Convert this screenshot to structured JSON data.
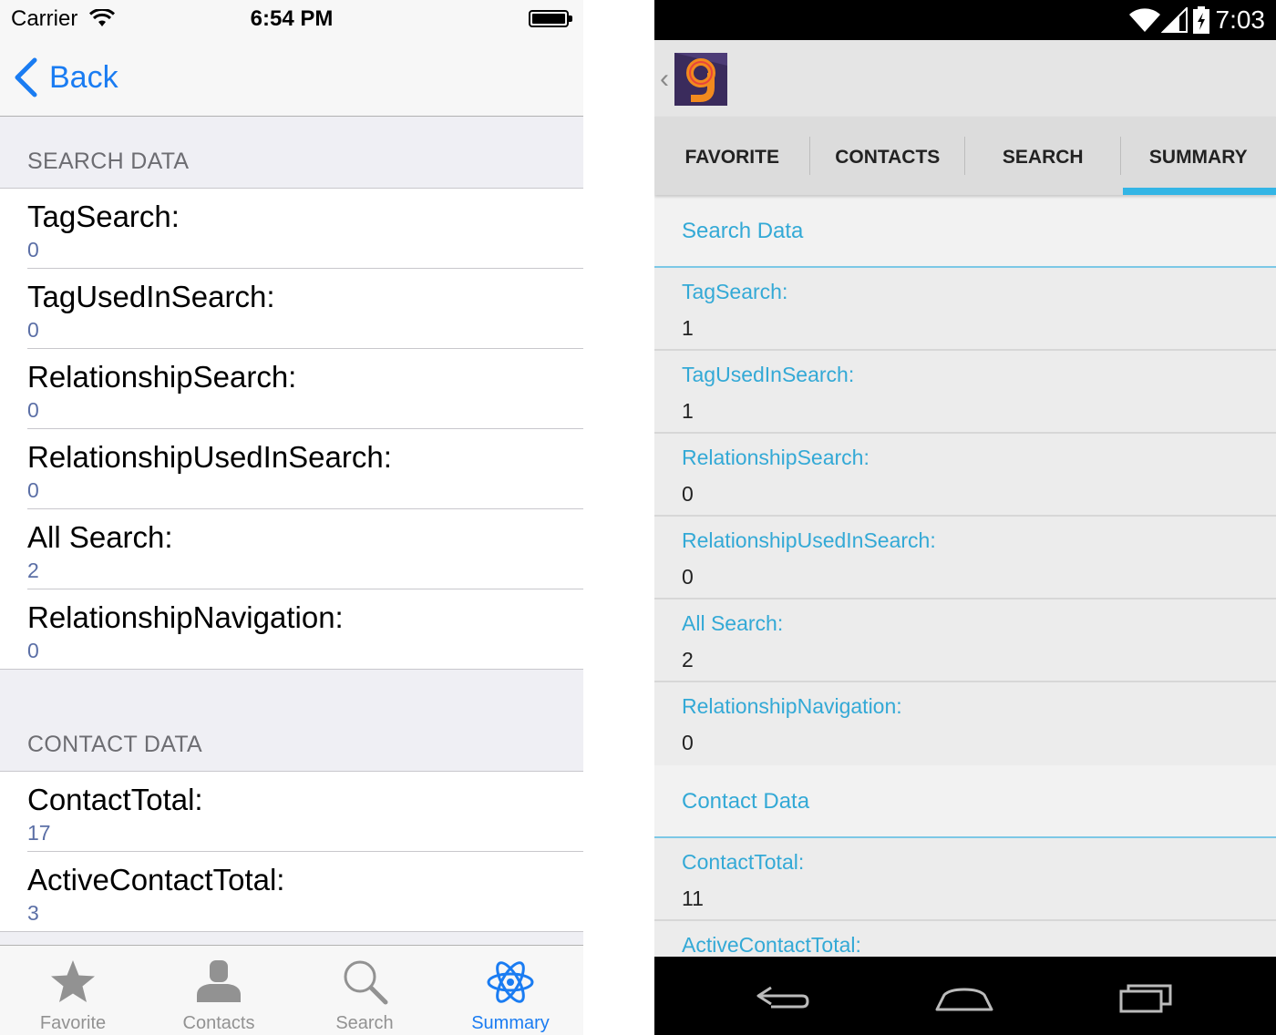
{
  "ios": {
    "status": {
      "carrier": "Carrier",
      "time": "6:54 PM"
    },
    "nav": {
      "back_label": "Back"
    },
    "sections": [
      {
        "header": "SEARCH DATA",
        "rows": [
          {
            "title": "TagSearch:",
            "value": "0"
          },
          {
            "title": "TagUsedInSearch:",
            "value": "0"
          },
          {
            "title": "RelationshipSearch:",
            "value": "0"
          },
          {
            "title": "RelationshipUsedInSearch:",
            "value": "0"
          },
          {
            "title": "All Search:",
            "value": "2"
          },
          {
            "title": "RelationshipNavigation:",
            "value": "0"
          }
        ]
      },
      {
        "header": "CONTACT DATA",
        "rows": [
          {
            "title": "ContactTotal:",
            "value": "17"
          },
          {
            "title": "ActiveContactTotal:",
            "value": "3"
          }
        ]
      }
    ],
    "tabs": [
      {
        "label": "Favorite",
        "icon": "star-icon"
      },
      {
        "label": "Contacts",
        "icon": "person-icon"
      },
      {
        "label": "Search",
        "icon": "magnifier-icon"
      },
      {
        "label": "Summary",
        "icon": "atom-icon",
        "active": true
      }
    ],
    "accent": "#1a7cf2"
  },
  "android": {
    "status": {
      "time": "7:03"
    },
    "tabs": [
      {
        "label": "FAVORITE"
      },
      {
        "label": "CONTACTS"
      },
      {
        "label": "SEARCH"
      },
      {
        "label": "SUMMARY",
        "active": true
      }
    ],
    "sections": [
      {
        "header": "Search Data",
        "rows": [
          {
            "title": "TagSearch:",
            "value": "1"
          },
          {
            "title": "TagUsedInSearch:",
            "value": "1"
          },
          {
            "title": "RelationshipSearch:",
            "value": "0"
          },
          {
            "title": "RelationshipUsedInSearch:",
            "value": "0"
          },
          {
            "title": "All Search:",
            "value": "2"
          },
          {
            "title": "RelationshipNavigation:",
            "value": "0"
          }
        ]
      },
      {
        "header": "Contact Data",
        "rows": [
          {
            "title": "ContactTotal:",
            "value": "11"
          },
          {
            "title": "ActiveContactTotal:",
            "value": ""
          }
        ]
      }
    ],
    "accent": "#33b5e5"
  }
}
